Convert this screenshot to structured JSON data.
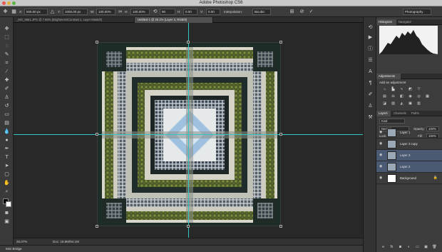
{
  "window": {
    "title": "Adobe Photoshop CS6",
    "workspace": "Photography"
  },
  "options_bar": {
    "x_label": "X:",
    "x_value": "500.00 px",
    "y_label": "Y:",
    "y_value": "1000.00 px",
    "w_label": "W:",
    "w_value": "100.00%",
    "h_label": "H:",
    "h_value": "100.00%",
    "angle_value": "90",
    "hskew_label": "H:",
    "hskew_value": "0.00",
    "vskew_label": "V:",
    "vskew_value": "0.00",
    "interpolation_label": "Interpolation:",
    "interpolation_value": "Bicubic"
  },
  "doc_tabs": [
    {
      "label": "_MG_8661.JPG @ 7.63% (Brightness/Contrast 1, Layer Mask/8)",
      "active": false
    },
    {
      "label": "Untitled-1 @ 25.1% (Layer 3, RGB/8)",
      "active": true
    }
  ],
  "status": {
    "zoom": "25.07%",
    "doc": "Doc: 18.8M/94.1M"
  },
  "mini_bridge": "Mini Bridge",
  "panels": {
    "top_tabs": [
      "Histogram",
      "Navigator"
    ],
    "adjust_tabs": [
      "Adjustments"
    ],
    "adjust_heading": "Add an adjustment",
    "layer_tabs": [
      "Layers",
      "Channels",
      "Paths"
    ],
    "kind_value": "Kind",
    "blend_mode": "Normal",
    "opacity_label": "Opacity:",
    "opacity_value": "100%",
    "lock_label": "Lock:",
    "fill_label": "Fill:",
    "fill_value": "100%",
    "layers": [
      {
        "name": "Layer 1",
        "selected": false,
        "locked": false
      },
      {
        "name": "Layer 3 copy",
        "selected": false,
        "locked": false
      },
      {
        "name": "Layer 3",
        "selected": true,
        "locked": false
      },
      {
        "name": "Layer 2",
        "selected": true,
        "locked": false
      },
      {
        "name": "Background",
        "selected": false,
        "locked": true
      }
    ]
  },
  "colors": {
    "guide": "#33c6c6",
    "selection": "#4a5a73",
    "canvas_bg": "#282828"
  }
}
